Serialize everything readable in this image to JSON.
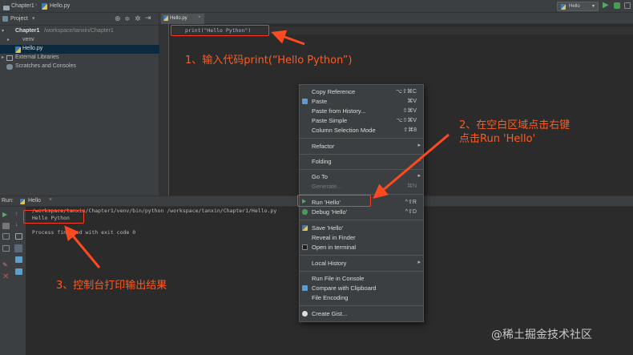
{
  "titlebar": {
    "project_crumb": "Chapter1",
    "file_crumb": "Hello.py",
    "run_config": "Hello"
  },
  "project_panel": {
    "header": "Project",
    "tree": [
      {
        "label": "Chapter1",
        "path": "/workspace/tanxin/Chapter1",
        "type": "folder"
      },
      {
        "label": "venv",
        "type": "folder-orange"
      },
      {
        "label": "Hello.py",
        "type": "python"
      },
      {
        "label": "External Libraries",
        "type": "library"
      },
      {
        "label": "Scratches and Consoles",
        "type": "scratches"
      }
    ]
  },
  "editor": {
    "tab": "Hello.py",
    "code": "print(\"Hello Python\")"
  },
  "run_panel": {
    "label": "Run:",
    "tab": "Hello",
    "console": [
      "/workspace/tanxin/Chapter1/venv/bin/python /workspace/tanxin/Chapter1/Hello.py",
      "Hello Python",
      "",
      "Process finished with exit code 0"
    ]
  },
  "context_menu": {
    "items": [
      {
        "label": "Copy Reference",
        "shortcut": "⌥⇧⌘C"
      },
      {
        "label": "Paste",
        "shortcut": "⌘V",
        "icon": "paste-icon"
      },
      {
        "label": "Paste from History...",
        "shortcut": "⇧⌘V"
      },
      {
        "label": "Paste Simple",
        "shortcut": "⌥⇧⌘V"
      },
      {
        "label": "Column Selection Mode",
        "shortcut": "⇧⌘8"
      },
      {
        "label": "Refactor",
        "submenu": "▸"
      },
      {
        "label": "Folding",
        "submenu": "▸"
      },
      {
        "label": "Go To",
        "submenu": "▸"
      },
      {
        "label": "Generate...",
        "shortcut": "⌘N",
        "disabled": true
      },
      {
        "label": "Run 'Hello'",
        "shortcut": "^⇧R",
        "icon": "run-icon"
      },
      {
        "label": "Debug 'Hello'",
        "shortcut": "^⇧D",
        "icon": "debug-icon"
      },
      {
        "label": "Save 'Hello'",
        "icon": "python-icon"
      },
      {
        "label": "Reveal in Finder"
      },
      {
        "label": "Open in terminal",
        "icon": "terminal-icon"
      },
      {
        "label": "Local History",
        "submenu": "▸"
      },
      {
        "label": "Run File in Console"
      },
      {
        "label": "Compare with Clipboard",
        "icon": "compare-icon"
      },
      {
        "label": "File Encoding"
      },
      {
        "label": "Create Gist...",
        "icon": "github-icon"
      }
    ]
  },
  "annotations": {
    "step1": "1、输入代码print(“Hello Python”)",
    "step2_line1": "2、在空白区域点击右键",
    "step2_line2": "点击Run 'Hello'",
    "step3": "3、控制台打印输出结果"
  },
  "watermark": "@稀土掘金技术社区",
  "colors": {
    "annotation": "#ff5a1f",
    "ide_background": "#2b2b2b",
    "panel": "#3c3f41",
    "selection": "#0d293e"
  }
}
